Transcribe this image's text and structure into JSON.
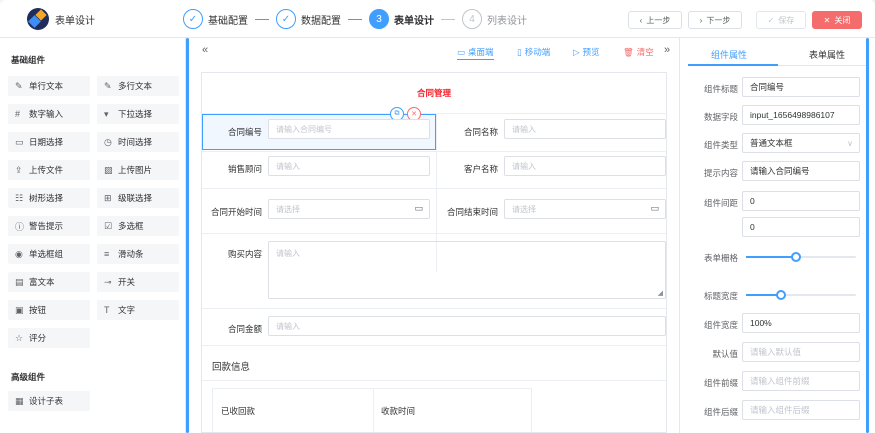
{
  "app": {
    "title": "表单设计"
  },
  "steps": [
    {
      "num": "✓",
      "label": "基础配置",
      "state": "done"
    },
    {
      "num": "✓",
      "label": "数据配置",
      "state": "done"
    },
    {
      "num": "3",
      "label": "表单设计",
      "state": "active"
    },
    {
      "num": "4",
      "label": "列表设计",
      "state": "todo"
    }
  ],
  "toolbar": {
    "prev": "上一步",
    "next": "下一步",
    "save": "保存",
    "close": "关闭"
  },
  "palette": {
    "basic_title": "基础组件",
    "basic": [
      {
        "icon": "✎",
        "label": "单行文本"
      },
      {
        "icon": "✎",
        "label": "多行文本"
      },
      {
        "icon": "#",
        "label": "数字输入"
      },
      {
        "icon": "▾",
        "label": "下拉选择"
      },
      {
        "icon": "▭",
        "label": "日期选择"
      },
      {
        "icon": "◷",
        "label": "时间选择"
      },
      {
        "icon": "⇪",
        "label": "上传文件"
      },
      {
        "icon": "▨",
        "label": "上传图片"
      },
      {
        "icon": "☷",
        "label": "树形选择"
      },
      {
        "icon": "⊞",
        "label": "级联选择"
      },
      {
        "icon": "ⓘ",
        "label": "警告提示"
      },
      {
        "icon": "☑",
        "label": "多选框"
      },
      {
        "icon": "◉",
        "label": "单选框组"
      },
      {
        "icon": "≡",
        "label": "滑动条"
      },
      {
        "icon": "▤",
        "label": "富文本"
      },
      {
        "icon": "⊸",
        "label": "开关"
      },
      {
        "icon": "▣",
        "label": "按钮"
      },
      {
        "icon": "T",
        "label": "文字"
      },
      {
        "icon": "☆",
        "label": "评分"
      }
    ],
    "advanced_title": "高级组件",
    "advanced": [
      {
        "icon": "▦",
        "label": "设计子表"
      }
    ]
  },
  "canvas_toolbar": {
    "collapse_left": "«",
    "desktop": "桌面端",
    "mobile": "移动端",
    "preview": "预览",
    "clear": "清空",
    "collapse_right": "»"
  },
  "form": {
    "title": "合同管理",
    "contract_no_label": "合同编号",
    "contract_no_ph": "请输入合同编号",
    "contract_name_label": "合同名称",
    "contract_name_ph": "请输入",
    "sales_label": "销售顾问",
    "sales_ph": "请输入",
    "customer_label": "客户名称",
    "customer_ph": "请输入",
    "start_label": "合同开始时间",
    "start_ph": "请选择",
    "end_label": "合同结束时间",
    "end_ph": "请选择",
    "purchase_label": "购买内容",
    "purchase_ph": "请输入",
    "amount_label": "合同金额",
    "amount_ph": "请输入",
    "section_title": "回款信息",
    "sub_cols": [
      "已收回款",
      "收款时间"
    ]
  },
  "props": {
    "tab_component": "组件属性",
    "tab_form": "表单属性",
    "title_label": "组件标题",
    "title_value": "合同编号",
    "field_label": "数据字段",
    "field_value": "input_1656498986107",
    "type_label": "组件类型",
    "type_value": "普通文本框",
    "hint_label": "提示内容",
    "hint_value": "请输入合同编号",
    "gap_label": "组件间距",
    "gap_value1": "0",
    "gap_value2": "0",
    "grid_label": "表单栅格",
    "grid_level": 0.45,
    "title_width_label": "标题宽度",
    "title_width_level": 0.32,
    "width_label": "组件宽度",
    "width_value": "100%",
    "default_label": "默认值",
    "default_ph": "请输入默认值",
    "prefix_label": "组件前缀",
    "prefix_ph": "请输入组件前缀",
    "suffix_label": "组件后缀",
    "suffix_ph": "请输入组件后缀"
  },
  "colors": {
    "primary": "#409eff",
    "danger": "#f56c6c",
    "title_red": "#f5222d"
  }
}
